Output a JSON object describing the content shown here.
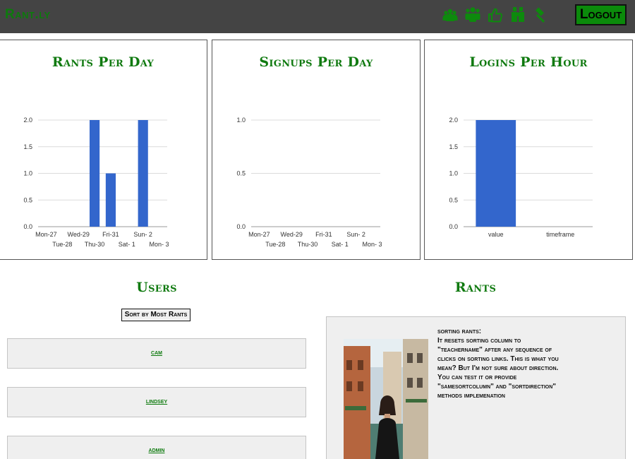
{
  "header": {
    "brand": "Rant.ly",
    "logout_label": "Logout",
    "icons": [
      "users-group-icon",
      "user-friends-icon",
      "thumbs-up-icon",
      "binoculars-icon",
      "gavel-icon"
    ]
  },
  "colors": {
    "header_bg": "#444444",
    "brand_green": "#0d7a0d",
    "bar_blue": "#3366cc",
    "card_bg": "#efefef"
  },
  "chart_data": [
    {
      "type": "bar",
      "title": "Rants Per Day",
      "categories": [
        "Mon-27",
        "Tue-28",
        "Wed-29",
        "Thu-30",
        "Fri-31",
        "Sat- 1",
        "Sun- 2",
        "Mon- 3"
      ],
      "values": [
        0,
        0,
        0,
        2,
        1,
        0,
        2,
        0
      ],
      "yticks": [
        "0.0",
        "0.5",
        "1.0",
        "1.5",
        "2.0"
      ],
      "ylim": [
        0,
        2
      ],
      "grid": true
    },
    {
      "type": "bar",
      "title": "Signups Per Day",
      "categories": [
        "Mon-27",
        "Tue-28",
        "Wed-29",
        "Thu-30",
        "Fri-31",
        "Sat- 1",
        "Sun- 2",
        "Mon- 3"
      ],
      "values": [
        0,
        0,
        0,
        0,
        0,
        0,
        0,
        0
      ],
      "yticks": [
        "0.0",
        "0.5",
        "1.0"
      ],
      "ylim": [
        0,
        1
      ],
      "grid": true
    },
    {
      "type": "bar",
      "title": "Logins Per Hour",
      "categories": [
        "value",
        "timeframe"
      ],
      "values": [
        2,
        0
      ],
      "yticks": [
        "0.0",
        "0.5",
        "1.0",
        "1.5",
        "2.0"
      ],
      "ylim": [
        0,
        2
      ],
      "grid": true
    }
  ],
  "users": {
    "title": "Users",
    "sort_label": "Sort by Most Rants",
    "list": [
      "cam",
      "lindsey",
      "admin"
    ]
  },
  "rants": {
    "title": "Rants",
    "items": [
      {
        "lines": [
          "sorting rants:",
          "It resets sorting column to",
          "\"teachername\" after any sequence of",
          "clicks on sorting links. This is what you",
          "mean? But I'm not sure about direction.",
          "You can test it or provide",
          "\"samesortcolumn\" and \"sortdirection\"",
          "methods implemenation"
        ]
      }
    ]
  }
}
